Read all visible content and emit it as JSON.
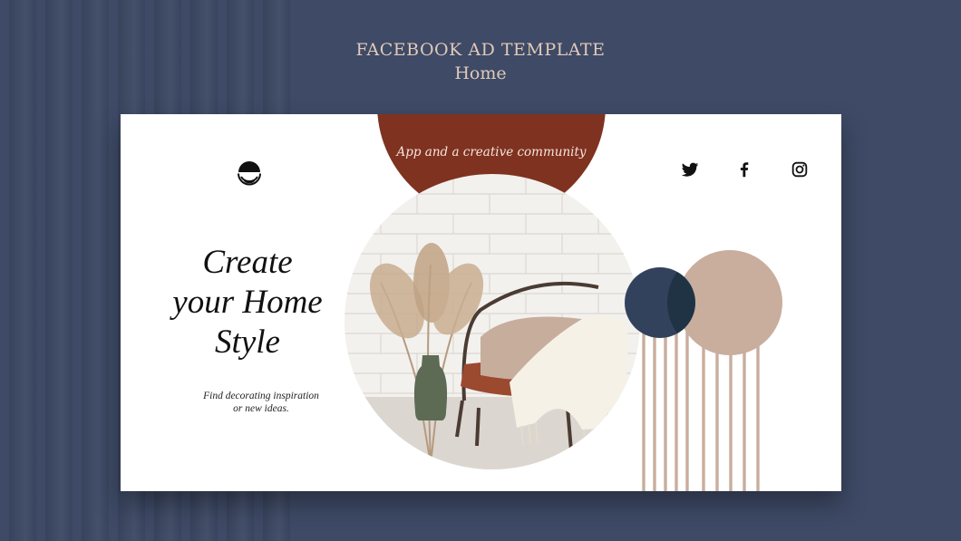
{
  "header": {
    "title": "FACEBOOK AD TEMPLATE",
    "subtitle": "Home"
  },
  "ad": {
    "tagline": "App and a creative community",
    "headline_lines": [
      "Create",
      "your Home",
      "Style"
    ],
    "subcopy_lines": [
      "Find decorating  inspiration",
      "or new ideas."
    ]
  },
  "social": [
    "twitter-icon",
    "facebook-icon",
    "instagram-icon"
  ],
  "colors": {
    "background": "#3e4a66",
    "card": "#ffffff",
    "terracotta": "#7f3220",
    "navy": "#33425c",
    "beige": "#c9ad9d",
    "tagline_text": "#f5e6dc",
    "header_text": "#e0c9b8"
  }
}
